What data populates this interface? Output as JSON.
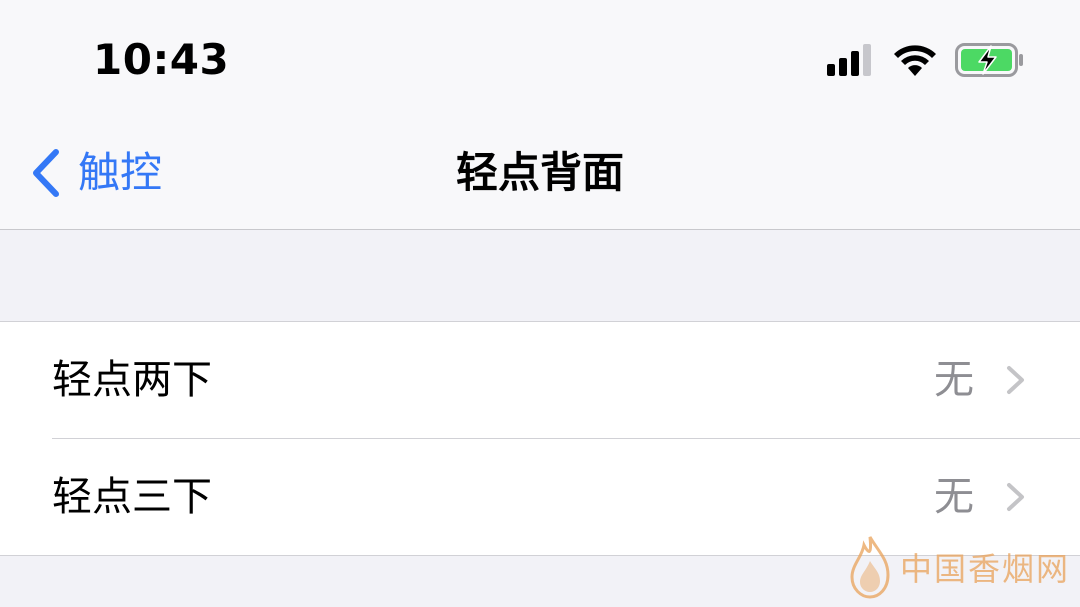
{
  "status_bar": {
    "time": "10:43",
    "icons": [
      "cellular-signal-icon",
      "wifi-icon",
      "battery-charging-icon"
    ]
  },
  "nav": {
    "back_label": "触控",
    "title": "轻点背面"
  },
  "settings": {
    "rows": [
      {
        "label": "轻点两下",
        "value": "无"
      },
      {
        "label": "轻点三下",
        "value": "无"
      }
    ]
  },
  "watermark": {
    "text": "中国香烟网"
  },
  "colors": {
    "accent": "#3478f6",
    "battery": "#4cd964",
    "secondary_text": "#8e8e93",
    "chevron": "#c4c4c7",
    "watermark": "#e9a25a"
  }
}
